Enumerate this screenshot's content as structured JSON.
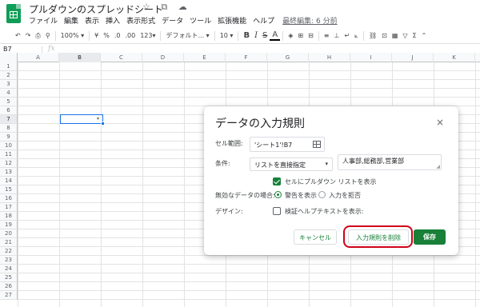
{
  "app": {
    "doc_title": "プルダウンのスプレッドシート",
    "title_icons": "☆ ⧉ ☁",
    "menu": [
      "ファイル",
      "編集",
      "表示",
      "挿入",
      "表示形式",
      "データ",
      "ツール",
      "拡張機能",
      "ヘルプ"
    ],
    "last_edit": "最終編集: 6 分前"
  },
  "toolbar": {
    "undo": "↶",
    "redo": "↷",
    "print": "⎙",
    "paint_format": "⚲",
    "zoom": "100%",
    "zoom_caret": "▾",
    "currency": "¥",
    "percent": "%",
    "decimal_decrease": ".0",
    "decimal_increase": ".00",
    "more_formats": "123",
    "more_formats_caret": "▾",
    "font": "デフォルト...",
    "font_caret": "▾",
    "font_size": "10",
    "font_size_caret": "▾",
    "bold": "B",
    "italic": "I",
    "strike": "S",
    "text_color": "A",
    "fill": "◈",
    "borders": "⊞",
    "merge": "⊟",
    "h_align": "≡",
    "v_align": "⊥",
    "wrap": "↵",
    "rotate": "⟀",
    "link": "⛓",
    "comment": "⊡",
    "chart": "▦",
    "filter": "▽",
    "functions": "Σ",
    "collapse": "⌃"
  },
  "formula_bar": {
    "name_box": "B7",
    "fx": "fx"
  },
  "grid": {
    "columns": [
      "A",
      "B",
      "C",
      "D",
      "E",
      "F",
      "G",
      "H",
      "I",
      "J",
      "K"
    ],
    "rows": [
      "1",
      "2",
      "3",
      "4",
      "5",
      "6",
      "7",
      "8",
      "9",
      "10",
      "11",
      "12",
      "13",
      "14",
      "15",
      "16",
      "17",
      "18",
      "19",
      "20",
      "21",
      "22",
      "23",
      "24",
      "25",
      "26",
      "27"
    ],
    "selected_col": "B",
    "selected_row": "7",
    "dropdown_caret": "▾"
  },
  "dialog": {
    "title": "データの入力規則",
    "close": "×",
    "range_label": "セル範囲:",
    "range_value": "'シート1'!B7",
    "criteria_label": "条件:",
    "criteria_value": "リストを直接指定",
    "criteria_caret": "▾",
    "list_value": "人事部,総務部,営業部",
    "resize_handle": "◢",
    "show_dropdown_label": "セルにプルダウン リストを表示",
    "show_dropdown_checked": true,
    "invalid_label": "無効なデータの場合:",
    "invalid_options": [
      "警告を表示",
      "入力を拒否"
    ],
    "invalid_selected": "警告を表示",
    "appearance_label": "デザイン:",
    "help_text_label": "検証ヘルプテキストを表示:",
    "help_text_checked": false,
    "cancel_label": "キャンセル",
    "remove_label": "入力規則を削除",
    "save_label": "保存"
  },
  "colors": {
    "accent_green": "#188038",
    "selection_blue": "#1a73e8",
    "highlight_red": "#d0021b"
  }
}
